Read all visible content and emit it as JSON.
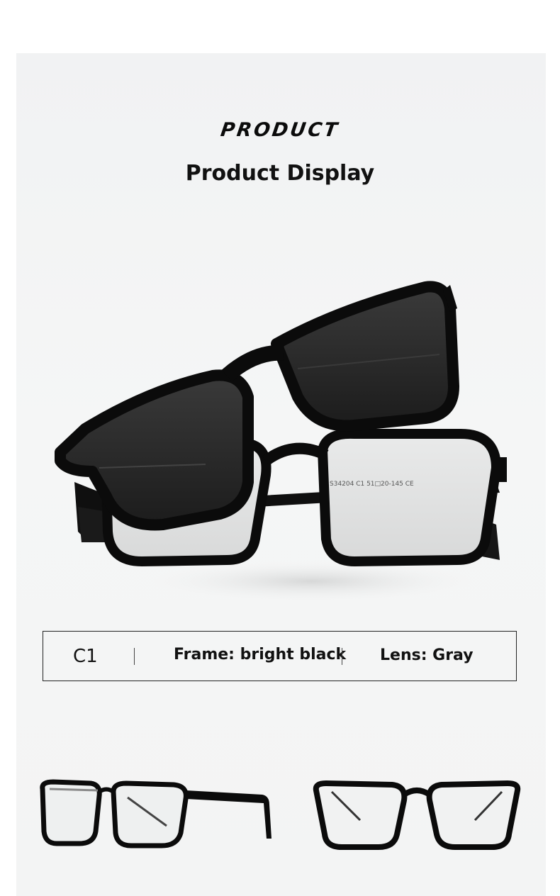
{
  "header": {
    "headline": "PRODUCT",
    "subheadline": "Product Display"
  },
  "spec": {
    "code": "C1",
    "frame": "Frame: bright black",
    "lens": "Lens: Gray"
  },
  "hero_image": {
    "temple_print": "S34204 C1 51□20-145 CE"
  },
  "colors": {
    "frame": "#0b0b0b",
    "lens_dark": "#2a2a2a",
    "background": "#f3f4f4"
  }
}
